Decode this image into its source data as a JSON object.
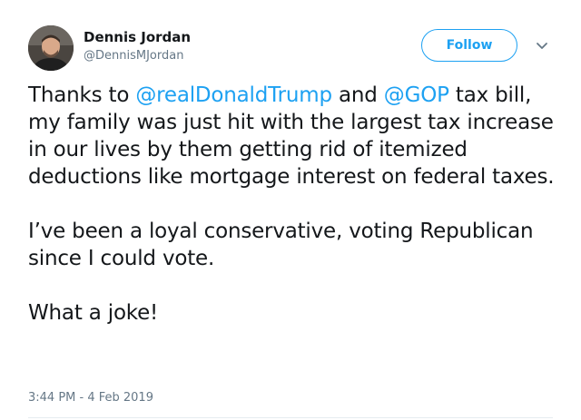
{
  "author": {
    "display_name": "Dennis Jordan",
    "handle": "@DennisMJordan"
  },
  "follow_label": "Follow",
  "tweet": {
    "para1": {
      "pre": "Thanks to ",
      "mention1": "@realDonaldTrump",
      "mid": " and ",
      "mention2": "@GOP",
      "post": " tax bill, my family was just hit with the largest tax increase in our lives by them getting rid of itemized deductions like mortgage interest on federal taxes."
    },
    "para2": "I’ve been a loyal conservative, voting Republican since I could vote.",
    "para3": "What a joke!"
  },
  "timestamp": "3:44 PM - 4 Feb 2019",
  "icons": {
    "more_menu": "chevron-down-icon"
  },
  "colors": {
    "link": "#1da1f2",
    "text": "#14171a",
    "secondary_text": "#657786",
    "divider": "#e6ecf0"
  }
}
